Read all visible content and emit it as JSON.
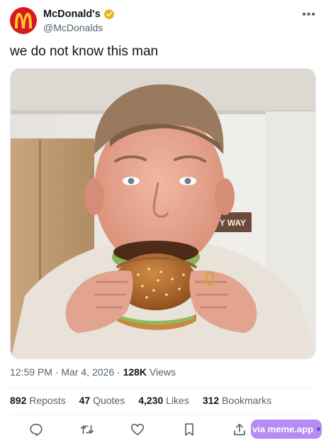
{
  "account": {
    "display_name": "McDonald's",
    "handle": "@McDonalds",
    "verified": true,
    "brand_color": "#d71920",
    "logo_color": "#ffc72c"
  },
  "tweet": {
    "text": "we do not know this man"
  },
  "media": {
    "sign_text": "ETTY WAY"
  },
  "meta": {
    "time": "12:59 PM",
    "separator": "·",
    "date": "Mar 4, 2026",
    "views_count": "128K",
    "views_label": "Views"
  },
  "stats": {
    "reposts_count": "892",
    "reposts_label": "Reposts",
    "quotes_count": "47",
    "quotes_label": "Quotes",
    "likes_count": "4,230",
    "likes_label": "Likes",
    "bookmarks_count": "312",
    "bookmarks_label": "Bookmarks"
  },
  "actions": {
    "icons": [
      "reply-icon",
      "retweet-icon",
      "like-icon",
      "bookmark-icon",
      "share-icon"
    ]
  },
  "watermark": {
    "text": "via meme.app",
    "color": "#b38df2"
  }
}
